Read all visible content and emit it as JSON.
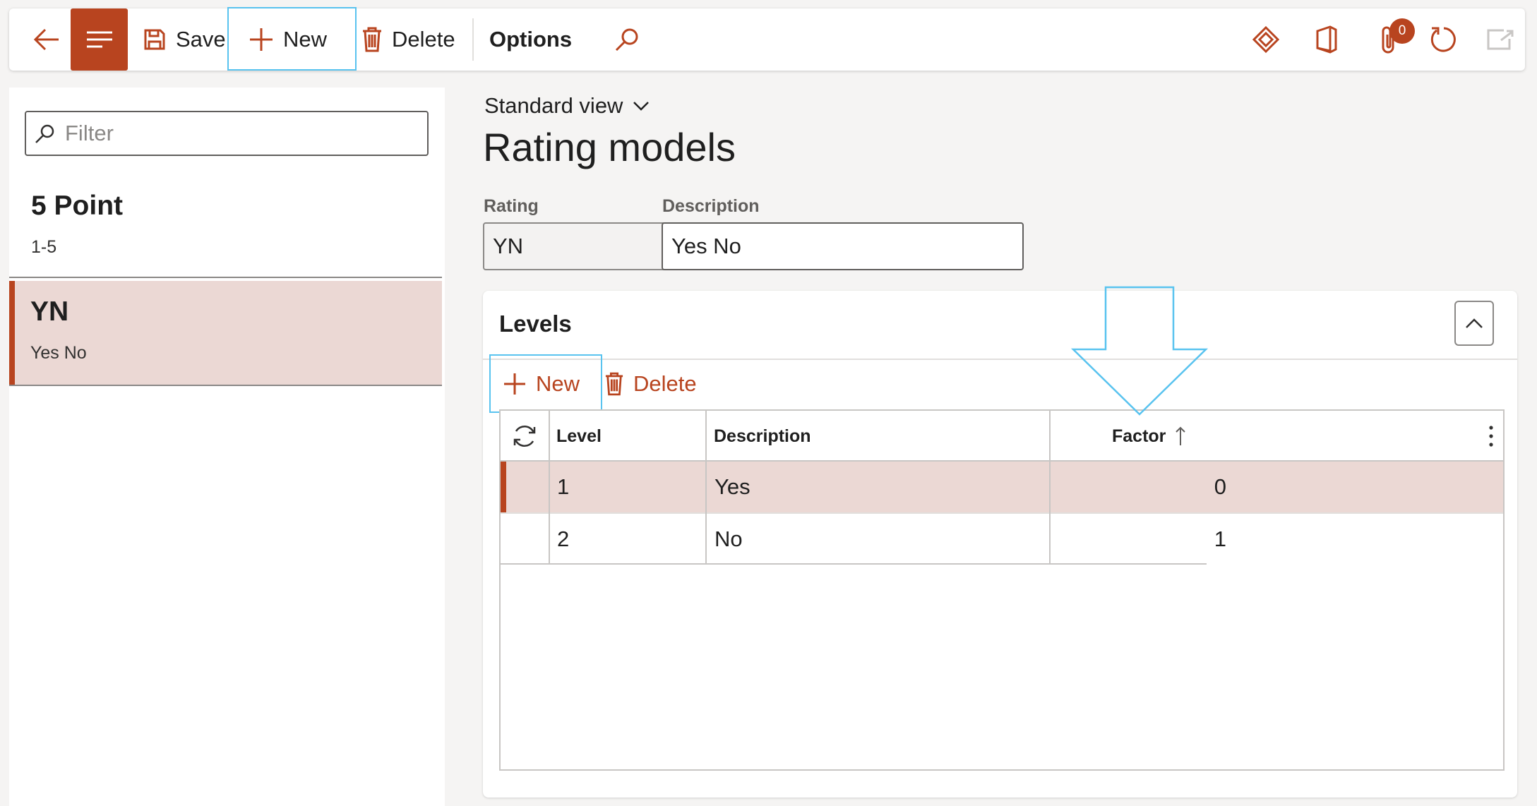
{
  "toolbar": {
    "save_label": "Save",
    "new_label": "New",
    "delete_label": "Delete",
    "options_label": "Options",
    "attachment_count": "0"
  },
  "list": {
    "filter_placeholder": "Filter",
    "items": [
      {
        "title": "5 Point",
        "subtitle": "1-5",
        "selected": false
      },
      {
        "title": "YN",
        "subtitle": "Yes No",
        "selected": true
      }
    ]
  },
  "main": {
    "view_label": "Standard view",
    "page_title": "Rating models",
    "fields": {
      "rating_label": "Rating",
      "rating_value": "YN",
      "description_label": "Description",
      "description_value": "Yes No"
    },
    "levels": {
      "section_title": "Levels",
      "new_label": "New",
      "delete_label": "Delete",
      "columns": [
        "Level",
        "Description",
        "Factor"
      ],
      "rows": [
        {
          "level": "1",
          "description": "Yes",
          "factor": "0",
          "selected": true
        },
        {
          "level": "2",
          "description": "No",
          "factor": "1",
          "selected": false
        }
      ]
    }
  },
  "colors": {
    "accent": "#b8441f",
    "selection": "#ebd8d4",
    "annotation": "#59c3ef"
  }
}
